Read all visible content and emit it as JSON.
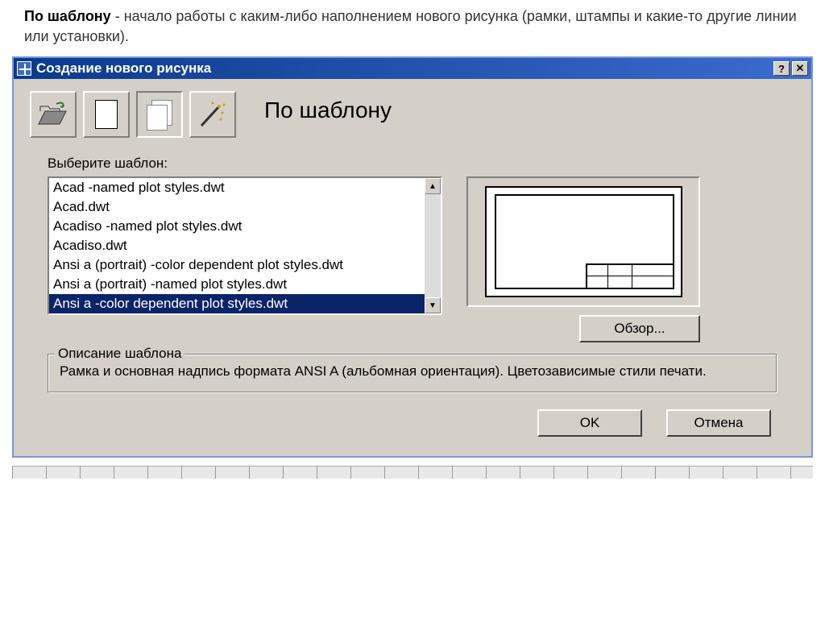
{
  "intro": {
    "bold": "По шаблону",
    "rest": " - начало работы с каким-либо наполнением нового рисунка (рамки, штампы и какие-то другие линии или установки)."
  },
  "window": {
    "title": "Создание нового рисунка",
    "help_symbol": "?",
    "close_symbol": "✕"
  },
  "mode_title": "По шаблону",
  "select_label": "Выберите шаблон:",
  "templates": [
    "Acad -named plot styles.dwt",
    "Acad.dwt",
    "Acadiso -named plot styles.dwt",
    "Acadiso.dwt",
    "Ansi a (portrait) -color dependent plot styles.dwt",
    "Ansi a (portrait) -named plot styles.dwt",
    "Ansi a -color dependent plot styles.dwt"
  ],
  "selected_index": 6,
  "browse_label": "Обзор...",
  "groupbox_title": "Описание шаблона",
  "description": "Рамка и основная надпись формата ANSI A (альбомная ориентация). Цветозависимые стили печати.",
  "buttons": {
    "ok": "OK",
    "cancel": "Отмена"
  },
  "scroll": {
    "up": "▲",
    "down": "▼"
  }
}
